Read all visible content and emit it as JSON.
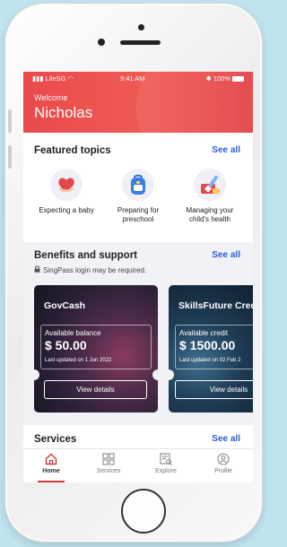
{
  "status_bar": {
    "carrier": "LifeSG",
    "time": "9:41 AM",
    "battery": "100%"
  },
  "header": {
    "welcome": "Welcome",
    "user_name": "Nicholas"
  },
  "featured": {
    "title": "Featured topics",
    "see_all": "See all",
    "topics": [
      {
        "label_line1": "Expecting a baby",
        "label_line2": "",
        "icon": "heart-hands-icon"
      },
      {
        "label_line1": "Preparing for",
        "label_line2": "preschool",
        "icon": "school-bag-icon"
      },
      {
        "label_line1": "Managing your",
        "label_line2": "child's health",
        "icon": "medical-kit-icon"
      }
    ]
  },
  "benefits": {
    "title": "Benefits and support",
    "see_all": "See all",
    "singpass_note": "SingPass login may be required.",
    "cards": [
      {
        "title": "GovCash",
        "balance_label": "Available balance",
        "amount": "$ 50.00",
        "updated": "Last updated on 1 Jun 2022",
        "button": "View details"
      },
      {
        "title": "SkillsFuture Cred",
        "balance_label": "Available credit",
        "amount": "$ 1500.00",
        "updated": "Last updated on 02 Feb 2",
        "button": "View details"
      }
    ]
  },
  "services": {
    "title": "Services",
    "see_all": "See all"
  },
  "tabs": [
    {
      "label": "Home",
      "icon": "home-icon",
      "active": true
    },
    {
      "label": "Services",
      "icon": "grid-icon",
      "active": false
    },
    {
      "label": "Explore",
      "icon": "explore-icon",
      "active": false
    },
    {
      "label": "Profile",
      "icon": "profile-icon",
      "active": false
    }
  ],
  "colors": {
    "header_red": "#e94a4c",
    "link_blue": "#2b5fd1",
    "tab_active": "#d03a3c"
  }
}
